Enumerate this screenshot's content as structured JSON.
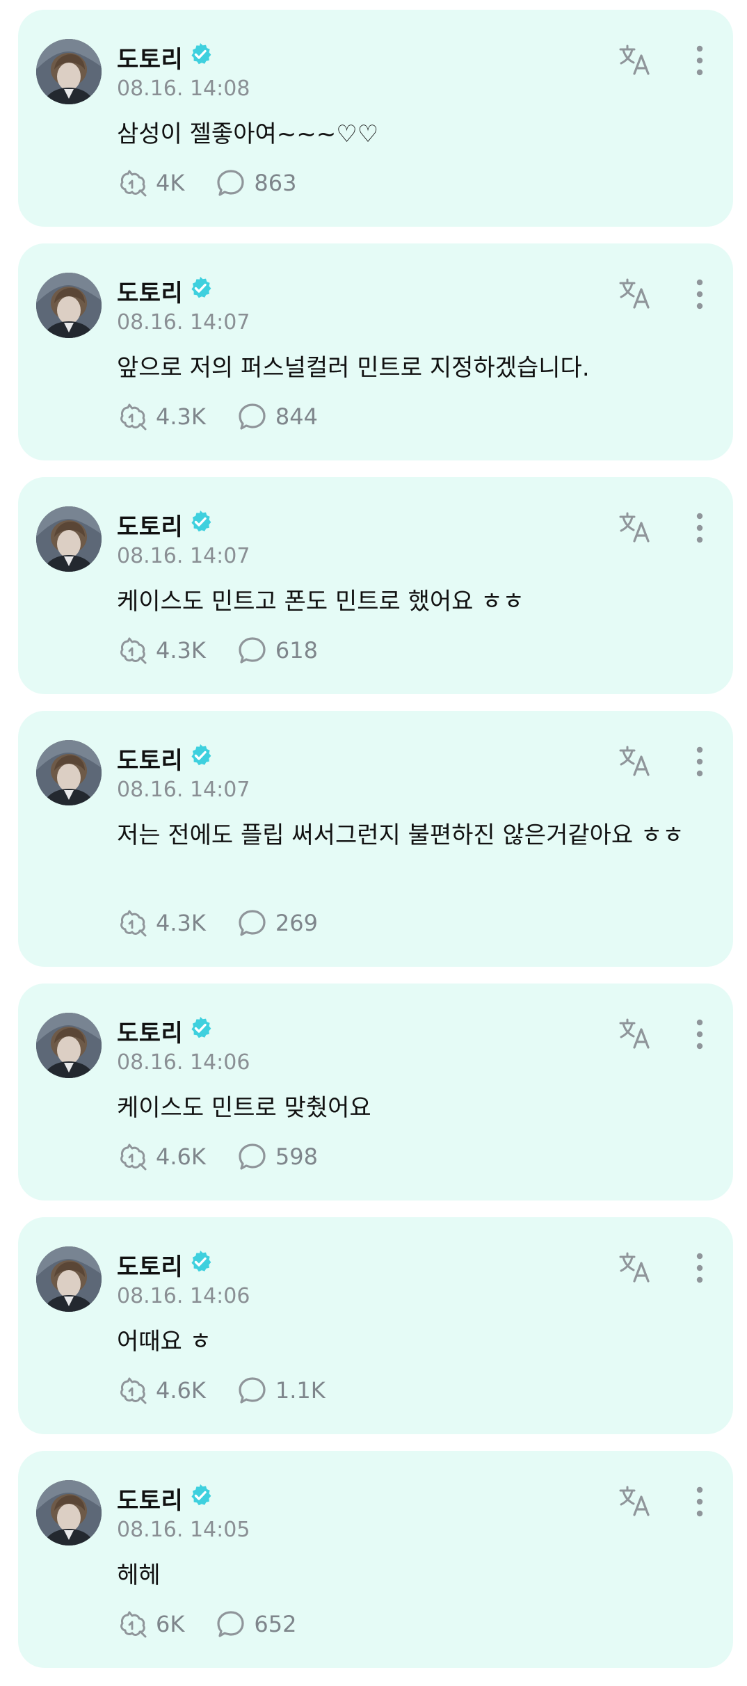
{
  "theme": {
    "card_bg": "#e5fbf6",
    "verified_color": "#3ed0de",
    "muted_text": "#8a8f94",
    "icon_color": "#8f959a"
  },
  "posts": [
    {
      "author": "도토리",
      "time": "08.16. 14:08",
      "text": "삼성이 젤좋아여~~~♡♡",
      "reposts": "4K",
      "comments": "863"
    },
    {
      "author": "도토리",
      "time": "08.16. 14:07",
      "text": "앞으로 저의 퍼스널컬러 민트로 지정하겠습니다.",
      "reposts": "4.3K",
      "comments": "844"
    },
    {
      "author": "도토리",
      "time": "08.16. 14:07",
      "text": "케이스도 민트고 폰도 민트로 했어요 ㅎㅎ",
      "reposts": "4.3K",
      "comments": "618"
    },
    {
      "author": "도토리",
      "time": "08.16. 14:07",
      "text": "저는 전에도 플립 써서그런지 불편하진 않은거같아요 ㅎㅎ",
      "reposts": "4.3K",
      "comments": "269"
    },
    {
      "author": "도토리",
      "time": "08.16. 14:06",
      "text": "케이스도 민트로 맞췄어요",
      "reposts": "4.6K",
      "comments": "598"
    },
    {
      "author": "도토리",
      "time": "08.16. 14:06",
      "text": "어때요 ㅎ",
      "reposts": "4.6K",
      "comments": "1.1K"
    },
    {
      "author": "도토리",
      "time": "08.16. 14:05",
      "text": "헤헤",
      "reposts": "6K",
      "comments": "652"
    }
  ]
}
